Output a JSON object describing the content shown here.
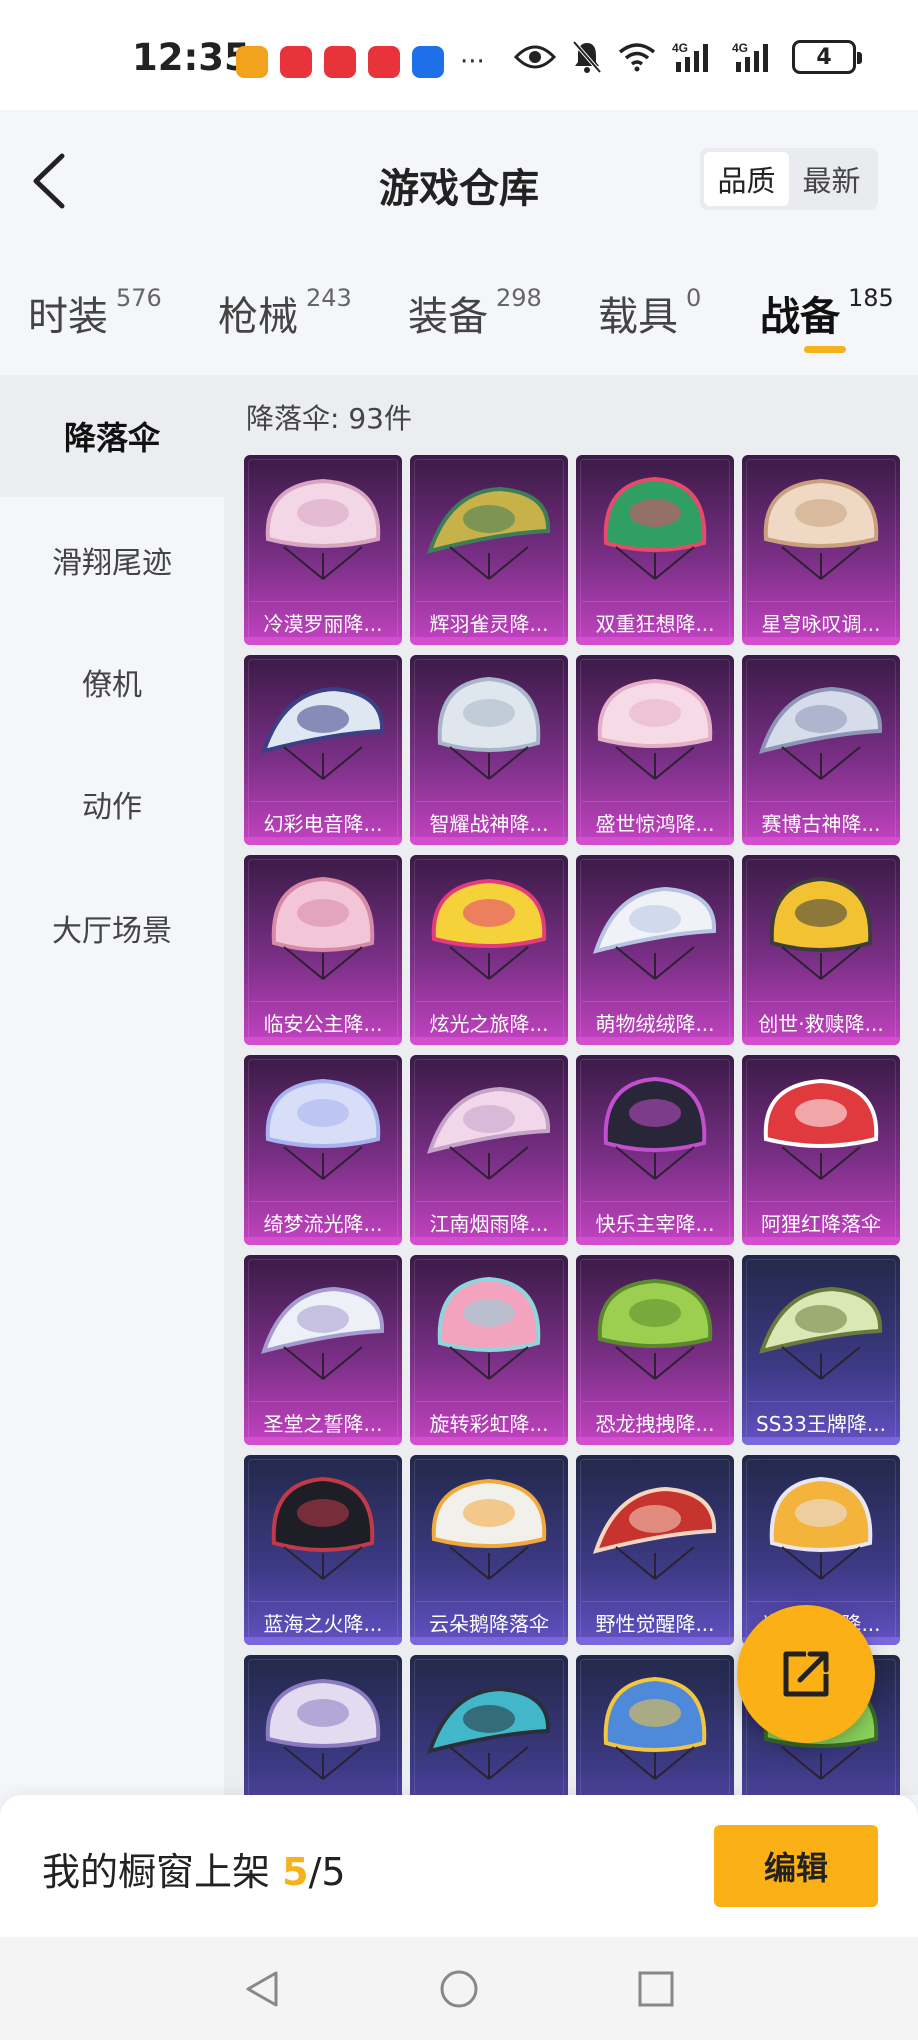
{
  "status_bar": {
    "time": "12:35",
    "battery": "4",
    "app_icons": [
      {
        "name": "app-icon-1",
        "color": "#f2a21c"
      },
      {
        "name": "huawei-icon-1",
        "color": "#e8333a"
      },
      {
        "name": "book-icon",
        "color": "#e8333a"
      },
      {
        "name": "huawei-icon-2",
        "color": "#e8333a"
      },
      {
        "name": "hint-icon",
        "color": "#1e70e8"
      }
    ],
    "more": "···"
  },
  "header": {
    "title": "游戏仓库",
    "sort_options": [
      "品质",
      "最新"
    ]
  },
  "category_tabs": [
    {
      "label": "时装",
      "count": "576"
    },
    {
      "label": "枪械",
      "count": "243"
    },
    {
      "label": "装备",
      "count": "298"
    },
    {
      "label": "载具",
      "count": "0"
    },
    {
      "label": "战备",
      "count": "185",
      "active": true
    }
  ],
  "sidebar": {
    "items": [
      "降落伞",
      "滑翔尾迹",
      "僚机",
      "动作",
      "大厅场景"
    ],
    "active_index": 0
  },
  "content": {
    "label": "降落伞: 93件",
    "items": [
      {
        "name": "冷漠罗丽降...",
        "rarity": "purple",
        "icon": "parachute-pink-lace",
        "colors": [
          "#f3d7e6",
          "#d7a4c2"
        ]
      },
      {
        "name": "辉羽雀灵降...",
        "rarity": "purple",
        "icon": "parachute-peacock-feather",
        "colors": [
          "#c7b24a",
          "#3e7d5a"
        ]
      },
      {
        "name": "双重狂想降...",
        "rarity": "purple",
        "icon": "parachute-dragon-mask",
        "colors": [
          "#2fa062",
          "#e64a6d"
        ]
      },
      {
        "name": "星穹咏叹调...",
        "rarity": "purple",
        "icon": "parachute-cream-face",
        "colors": [
          "#efd9c4",
          "#c9a07e"
        ]
      },
      {
        "name": "幻彩电音降...",
        "rarity": "purple",
        "icon": "parachute-graffiti",
        "colors": [
          "#dfe8f2",
          "#3b3f86"
        ]
      },
      {
        "name": "智耀战神降...",
        "rarity": "purple",
        "icon": "parachute-lotus-blue",
        "colors": [
          "#dfe6ee",
          "#a9b6c9"
        ]
      },
      {
        "name": "盛世惊鸿降...",
        "rarity": "purple",
        "icon": "parachute-pink-jelly",
        "colors": [
          "#f6dbe6",
          "#e6afc8"
        ]
      },
      {
        "name": "赛博古神降...",
        "rarity": "purple",
        "icon": "parachute-glass-wing",
        "colors": [
          "#d7dceb",
          "#8e96b8"
        ]
      },
      {
        "name": "临安公主降...",
        "rarity": "purple",
        "icon": "parachute-pink-wing",
        "colors": [
          "#f2c6d6",
          "#d68aa8"
        ]
      },
      {
        "name": "炫光之旅降...",
        "rarity": "purple",
        "icon": "parachute-colorful-box",
        "colors": [
          "#f5d23a",
          "#e43c7b"
        ]
      },
      {
        "name": "萌物绒绒降...",
        "rarity": "purple",
        "icon": "parachute-white-dome",
        "colors": [
          "#f1f2f7",
          "#b6c4e3"
        ]
      },
      {
        "name": "创世·救赎降...",
        "rarity": "purple",
        "icon": "parachute-gold-black",
        "colors": [
          "#f2c233",
          "#3d3c3e"
        ]
      },
      {
        "name": "绮梦流光降...",
        "rarity": "purple",
        "icon": "parachute-jellyfish",
        "colors": [
          "#d8def7",
          "#a7b3ef"
        ]
      },
      {
        "name": "江南烟雨降...",
        "rarity": "purple",
        "icon": "parachute-flower-petal",
        "colors": [
          "#f2d6ea",
          "#c3a3c6"
        ]
      },
      {
        "name": "快乐主宰降...",
        "rarity": "purple",
        "icon": "parachute-my-game",
        "colors": [
          "#29263a",
          "#c24fcc"
        ]
      },
      {
        "name": "阿狸红降落伞",
        "rarity": "purple",
        "icon": "parachute-red-tail",
        "colors": [
          "#e03a3f",
          "#ffffff"
        ]
      },
      {
        "name": "圣堂之誓降...",
        "rarity": "purple",
        "icon": "parachute-white-gold",
        "colors": [
          "#eef0f7",
          "#a69bd0"
        ]
      },
      {
        "name": "旋转彩虹降...",
        "rarity": "purple",
        "icon": "parachute-pink-cake",
        "colors": [
          "#f4a3be",
          "#8dd6dc"
        ]
      },
      {
        "name": "恐龙拽拽降...",
        "rarity": "purple",
        "icon": "parachute-dino",
        "colors": [
          "#9ccf4f",
          "#5b8a2d"
        ]
      },
      {
        "name": "SS33王牌降...",
        "rarity": "blue",
        "icon": "parachute-ss33",
        "colors": [
          "#d8e9b6",
          "#6b7a3c"
        ]
      },
      {
        "name": "蓝海之火降...",
        "rarity": "blue",
        "icon": "parachute-black-red",
        "colors": [
          "#1e1f26",
          "#c23a4a"
        ]
      },
      {
        "name": "云朵鹅降落伞",
        "rarity": "blue",
        "icon": "parachute-goose",
        "colors": [
          "#f2f0ea",
          "#f2a93b"
        ]
      },
      {
        "name": "野性觉醒降...",
        "rarity": "blue",
        "icon": "parachute-red-fire",
        "colors": [
          "#c7332f",
          "#f5d6c0"
        ]
      },
      {
        "name": "光荣之翼降...",
        "rarity": "blue",
        "icon": "parachute-orange-wing",
        "colors": [
          "#f4b43b",
          "#e8e6f3"
        ]
      },
      {
        "name": "",
        "rarity": "blue",
        "icon": "parachute-lavender",
        "colors": [
          "#e3dcf1",
          "#8a7bbf"
        ]
      },
      {
        "name": "",
        "rarity": "blue",
        "icon": "parachute-teal-tiger",
        "colors": [
          "#42b7c9",
          "#2b2f3c"
        ]
      },
      {
        "name": "",
        "rarity": "blue",
        "icon": "parachute-sunflower",
        "colors": [
          "#4f89d9",
          "#f2c740"
        ]
      },
      {
        "name": "",
        "rarity": "blue",
        "icon": "parachute-green",
        "colors": [
          "#8bd15b",
          "#3a6d27"
        ]
      }
    ]
  },
  "fab": {
    "icon": "share-icon"
  },
  "bottom_bar": {
    "label": "我的橱窗上架",
    "count": "5",
    "total": "/5",
    "edit_label": "编辑"
  },
  "accent_color": "#fbb016"
}
